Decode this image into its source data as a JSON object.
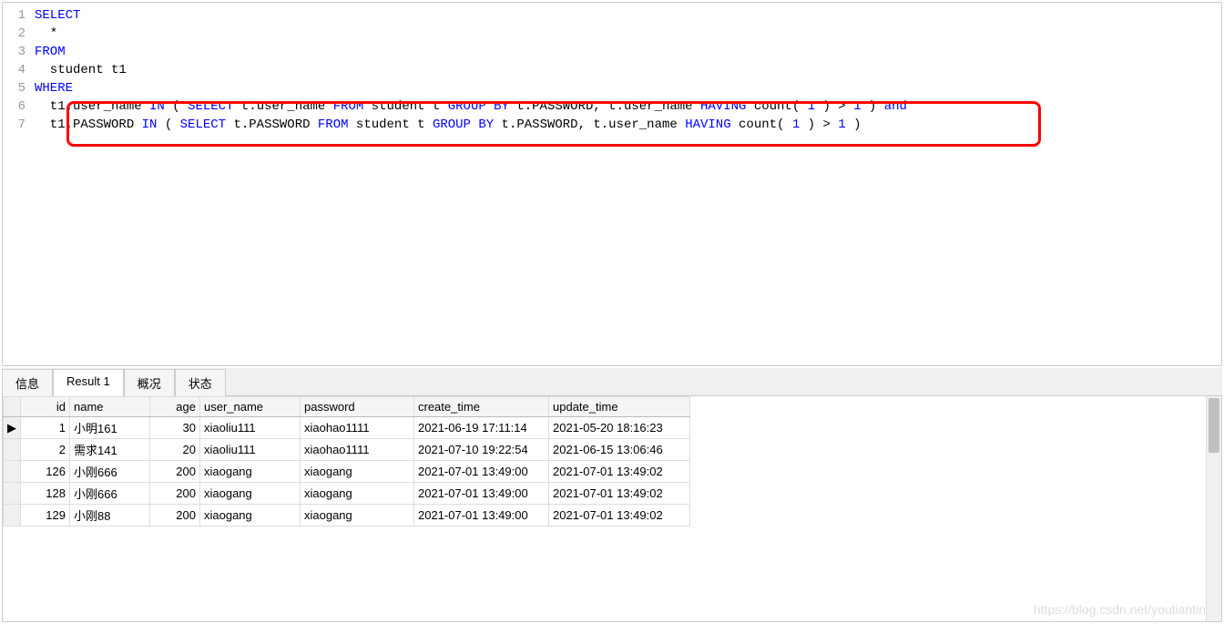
{
  "editor": {
    "lines": [
      {
        "n": "1",
        "tokens": [
          {
            "t": "SELECT",
            "c": "kw"
          }
        ]
      },
      {
        "n": "2",
        "tokens": [
          {
            "t": "  *",
            "c": "id"
          }
        ]
      },
      {
        "n": "3",
        "tokens": [
          {
            "t": "FROM",
            "c": "kw"
          }
        ]
      },
      {
        "n": "4",
        "tokens": [
          {
            "t": "  student t1",
            "c": "id"
          }
        ]
      },
      {
        "n": "5",
        "tokens": [
          {
            "t": "WHERE",
            "c": "kw"
          }
        ]
      },
      {
        "n": "6",
        "tokens": [
          {
            "t": "  t1.user_name ",
            "c": "id"
          },
          {
            "t": "IN",
            "c": "kw"
          },
          {
            "t": " ( ",
            "c": "id"
          },
          {
            "t": "SELECT",
            "c": "kw"
          },
          {
            "t": " t.user_name ",
            "c": "id"
          },
          {
            "t": "FROM",
            "c": "kw"
          },
          {
            "t": " student t ",
            "c": "id"
          },
          {
            "t": "GROUP BY",
            "c": "kw"
          },
          {
            "t": " t.PASSWORD, t.user_name ",
            "c": "id"
          },
          {
            "t": "HAVING",
            "c": "kw"
          },
          {
            "t": " count( ",
            "c": "id"
          },
          {
            "t": "1",
            "c": "num"
          },
          {
            "t": " ) > ",
            "c": "id"
          },
          {
            "t": "1",
            "c": "num"
          },
          {
            "t": " ) ",
            "c": "id"
          },
          {
            "t": "and",
            "c": "kw"
          }
        ]
      },
      {
        "n": "7",
        "tokens": [
          {
            "t": "  t1.PASSWORD ",
            "c": "id"
          },
          {
            "t": "IN",
            "c": "kw"
          },
          {
            "t": " ( ",
            "c": "id"
          },
          {
            "t": "SELECT",
            "c": "kw"
          },
          {
            "t": " t.PASSWORD ",
            "c": "id"
          },
          {
            "t": "FROM",
            "c": "kw"
          },
          {
            "t": " student t ",
            "c": "id"
          },
          {
            "t": "GROUP BY",
            "c": "kw"
          },
          {
            "t": " t.PASSWORD, t.user_name ",
            "c": "id"
          },
          {
            "t": "HAVING",
            "c": "kw"
          },
          {
            "t": " count( ",
            "c": "id"
          },
          {
            "t": "1",
            "c": "num"
          },
          {
            "t": " ) > ",
            "c": "id"
          },
          {
            "t": "1",
            "c": "num"
          },
          {
            "t": " )",
            "c": "id"
          }
        ]
      }
    ]
  },
  "tabs": {
    "items": [
      {
        "label": "信息",
        "active": false
      },
      {
        "label": "Result 1",
        "active": true
      },
      {
        "label": "概况",
        "active": false
      },
      {
        "label": "状态",
        "active": false
      }
    ]
  },
  "result": {
    "columns": [
      "id",
      "name",
      "age",
      "user_name",
      "password",
      "create_time",
      "update_time"
    ],
    "rows": [
      {
        "marker": "▶",
        "id": "1",
        "name": "小明161",
        "age": "30",
        "user_name": "xiaoliu111",
        "password": "xiaohao1111",
        "create_time": "2021-06-19 17:11:14",
        "update_time": "2021-05-20 18:16:23"
      },
      {
        "marker": "",
        "id": "2",
        "name": "需求141",
        "age": "20",
        "user_name": "xiaoliu111",
        "password": "xiaohao1111",
        "create_time": "2021-07-10 19:22:54",
        "update_time": "2021-06-15 13:06:46"
      },
      {
        "marker": "",
        "id": "126",
        "name": "小刚666",
        "age": "200",
        "user_name": "xiaogang",
        "password": "xiaogang",
        "create_time": "2021-07-01 13:49:00",
        "update_time": "2021-07-01 13:49:02"
      },
      {
        "marker": "",
        "id": "128",
        "name": "小刚666",
        "age": "200",
        "user_name": "xiaogang",
        "password": "xiaogang",
        "create_time": "2021-07-01 13:49:00",
        "update_time": "2021-07-01 13:49:02"
      },
      {
        "marker": "",
        "id": "129",
        "name": "小刚88",
        "age": "200",
        "user_name": "xiaogang",
        "password": "xiaogang",
        "create_time": "2021-07-01 13:49:00",
        "update_time": "2021-07-01 13:49:02"
      }
    ]
  },
  "watermark": "https://blog.csdn.net/youtiantin"
}
